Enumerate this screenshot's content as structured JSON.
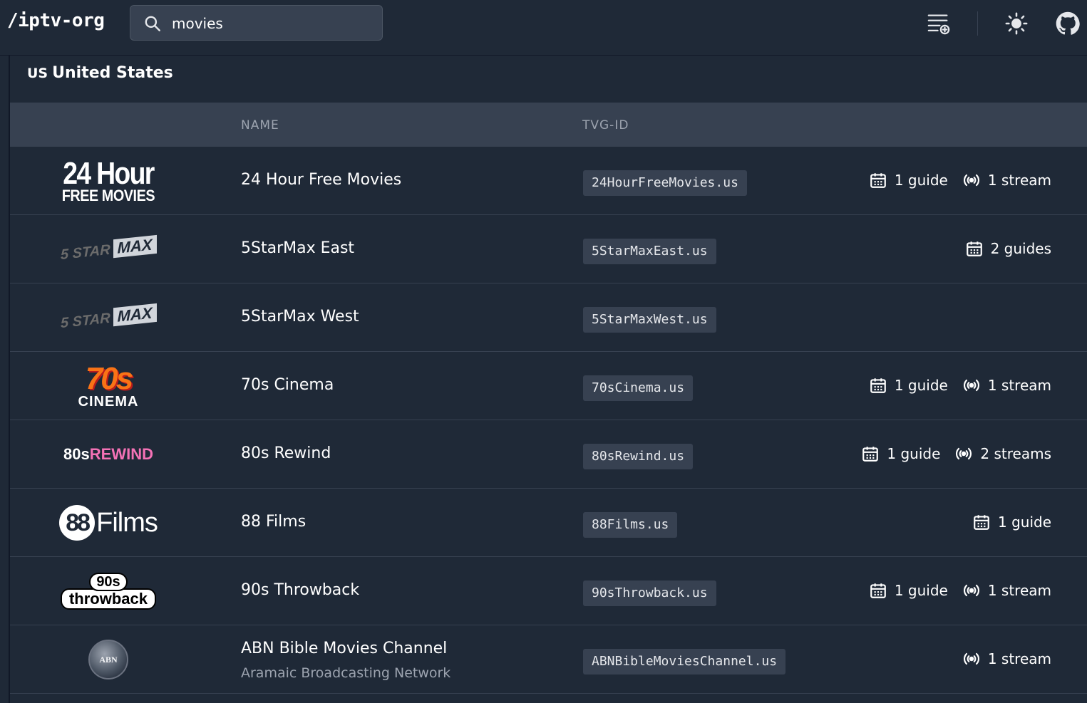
{
  "app": {
    "brand": "/iptv-org"
  },
  "search": {
    "value": "movies",
    "placeholder": ""
  },
  "section": {
    "country_code": "US",
    "country_name": "United States"
  },
  "table": {
    "headers": {
      "name": "NAME",
      "tvg_id": "TVG-ID"
    },
    "rows": [
      {
        "name": "24 Hour Free Movies",
        "subname": "",
        "tvg_id": "24HourFreeMovies.us",
        "guides": "1 guide",
        "streams": "1 stream",
        "logo_line1": "24 Hour",
        "logo_line2": "FREE MOVIES"
      },
      {
        "name": "5StarMax East",
        "subname": "",
        "tvg_id": "5StarMaxEast.us",
        "guides": "2 guides",
        "streams": "",
        "logo_line1": "5 STAR",
        "logo_line2": "MAX"
      },
      {
        "name": "5StarMax West",
        "subname": "",
        "tvg_id": "5StarMaxWest.us",
        "guides": "",
        "streams": "",
        "logo_line1": "5 STAR",
        "logo_line2": "MAX"
      },
      {
        "name": "70s Cinema",
        "subname": "",
        "tvg_id": "70sCinema.us",
        "guides": "1 guide",
        "streams": "1 stream",
        "logo_line1": "70s",
        "logo_line2": "CINEMA"
      },
      {
        "name": "80s Rewind",
        "subname": "",
        "tvg_id": "80sRewind.us",
        "guides": "1 guide",
        "streams": "2 streams",
        "logo_line1": "80s",
        "logo_line2": "REWIND"
      },
      {
        "name": "88 Films",
        "subname": "",
        "tvg_id": "88Films.us",
        "guides": "1 guide",
        "streams": "",
        "logo_line1": "88",
        "logo_line2": "Films"
      },
      {
        "name": "90s Throwback",
        "subname": "",
        "tvg_id": "90sThrowback.us",
        "guides": "1 guide",
        "streams": "1 stream",
        "logo_line1": "90s",
        "logo_line2": "throwback"
      },
      {
        "name": "ABN Bible Movies Channel",
        "subname": "Aramaic Broadcasting Network",
        "tvg_id": "ABNBibleMoviesChannel.us",
        "guides": "",
        "streams": "1 stream",
        "logo_line1": "ABN",
        "logo_line2": ""
      }
    ]
  },
  "colors": {
    "background": "#1f2937",
    "header_row": "#374151",
    "muted_text": "#9ca3af",
    "code_bg": "#374151"
  },
  "icons": {
    "search": "search-icon",
    "playlist": "playlist-add-icon",
    "theme": "sun-icon",
    "github": "github-icon",
    "guide": "calendar-icon",
    "stream": "broadcast-icon"
  }
}
